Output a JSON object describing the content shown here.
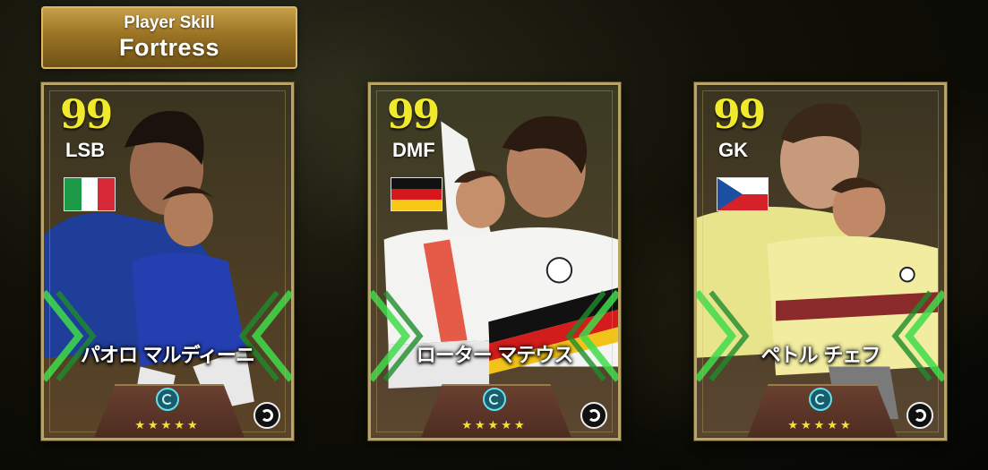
{
  "skill_banner": {
    "label": "Player Skill",
    "skill": "Fortress"
  },
  "cards": [
    {
      "rating": "99",
      "position": "LSB",
      "flag": "italy",
      "name": "パオロ マルディーニ",
      "stars": "★★★★★"
    },
    {
      "rating": "99",
      "position": "DMF",
      "flag": "germany",
      "name": "ローター マテウス",
      "stars": "★★★★★"
    },
    {
      "rating": "99",
      "position": "GK",
      "flag": "czech-republic",
      "name": "ペトル チェフ",
      "stars": "★★★★★"
    }
  ],
  "colors": {
    "rating": "#f1ea2c",
    "card_border": "#b7a466",
    "chevron_glow": "#3fdc4a",
    "banner_gold": "#c9a24a"
  },
  "icons": [
    "skill-badge-icon",
    "efootball-logo-icon"
  ]
}
